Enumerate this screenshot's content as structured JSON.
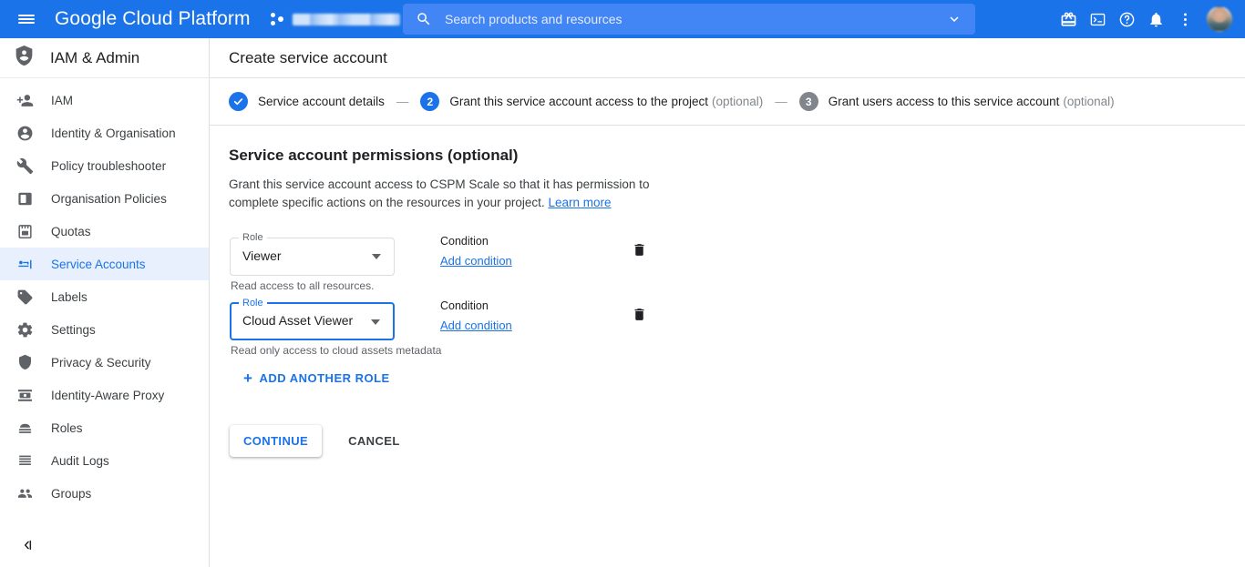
{
  "topbar": {
    "brand": "Google Cloud Platform",
    "menu_icon": "hamburger-icon",
    "project_selector": {
      "name": "",
      "icon": "project-dots-icon",
      "caret": "chevron-down-icon"
    },
    "search": {
      "placeholder": "Search products and resources",
      "value": "",
      "icon": "search-icon",
      "caret": "chevron-down-icon"
    },
    "icons": [
      {
        "name": "gift-icon",
        "label": "Offers"
      },
      {
        "name": "cloud-shell-icon",
        "label": "Activate Cloud Shell"
      },
      {
        "name": "help-icon",
        "label": "Support"
      },
      {
        "name": "notifications-bell-icon",
        "label": "Notifications"
      },
      {
        "name": "more-vert-icon",
        "label": "Settings and more"
      }
    ],
    "avatar": "user-avatar"
  },
  "sidebar": {
    "header": {
      "title": "IAM & Admin",
      "icon": "iam-shield-icon"
    },
    "items": [
      {
        "label": "IAM",
        "icon": "person-add-icon",
        "selected": false
      },
      {
        "label": "Identity & Organisation",
        "icon": "account-circle-icon",
        "selected": false
      },
      {
        "label": "Policy troubleshooter",
        "icon": "wrench-icon",
        "selected": false
      },
      {
        "label": "Organisation Policies",
        "icon": "policy-board-icon",
        "selected": false
      },
      {
        "label": "Quotas",
        "icon": "quotas-icon",
        "selected": false
      },
      {
        "label": "Service Accounts",
        "icon": "service-account-key-icon",
        "selected": true
      },
      {
        "label": "Labels",
        "icon": "label-tag-icon",
        "selected": false
      },
      {
        "label": "Settings",
        "icon": "gear-icon",
        "selected": false
      },
      {
        "label": "Privacy & Security",
        "icon": "shield-icon",
        "selected": false
      },
      {
        "label": "Identity-Aware Proxy",
        "icon": "iap-icon",
        "selected": false
      },
      {
        "label": "Roles",
        "icon": "roles-icon",
        "selected": false
      },
      {
        "label": "Audit Logs",
        "icon": "audit-logs-icon",
        "selected": false
      },
      {
        "label": "Groups",
        "icon": "groups-icon",
        "selected": false
      }
    ],
    "collapse": {
      "icon": "collapse-panel-icon"
    }
  },
  "page": {
    "title": "Create service account",
    "stepper": {
      "steps": [
        {
          "number": "1",
          "state": "done",
          "label": "Service account details",
          "optional": ""
        },
        {
          "number": "2",
          "state": "active",
          "label": "Grant this service account access to the project",
          "optional": "(optional)"
        },
        {
          "number": "3",
          "state": "todo",
          "label": "Grant users access to this service account",
          "optional": "(optional)"
        }
      ],
      "separator": "—",
      "check_glyph": "✓"
    },
    "section": {
      "title": "Service account permissions (optional)",
      "description": "Grant this service account access to CSPM Scale so that it has permission to complete specific actions on the resources in your project.",
      "learn_more": "Learn more"
    },
    "roles": [
      {
        "field_label": "Role",
        "value": "Viewer",
        "help": "Read access to all resources.",
        "focused": false,
        "condition_label": "Condition",
        "condition_link": "Add condition",
        "delete_icon": "delete-trash-icon"
      },
      {
        "field_label": "Role",
        "value": "Cloud Asset Viewer",
        "help": "Read only access to cloud assets metadata",
        "focused": true,
        "condition_label": "Condition",
        "condition_link": "Add condition",
        "delete_icon": "delete-trash-icon"
      }
    ],
    "add_role": {
      "plus": "+",
      "label": "ADD ANOTHER ROLE"
    },
    "actions": {
      "continue": "CONTINUE",
      "cancel": "CANCEL"
    }
  },
  "colors": {
    "brand_blue": "#1a73e8",
    "topbar_blue": "#1a73e8",
    "search_blue": "#4285f4",
    "selected_bg": "#e8f0fe",
    "text_primary": "#202124",
    "text_secondary": "#5f6368",
    "step_todo": "#80868b"
  }
}
